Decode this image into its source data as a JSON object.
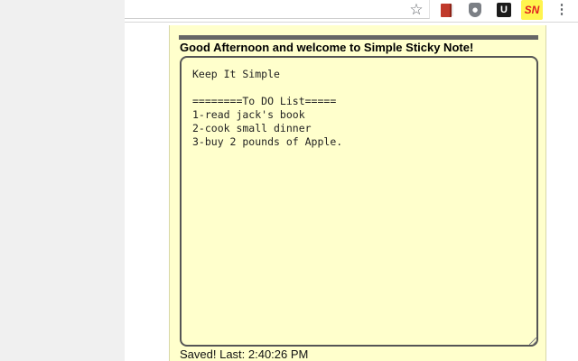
{
  "browser": {
    "toolbar_icons": [
      "bookmark-star-icon",
      "book-extension-icon",
      "shield-extension-icon",
      "u-extension-icon",
      "simple-sticky-note-extension-icon",
      "menu-dots-icon"
    ],
    "star_glyph": "☆",
    "u_extension_label": "U",
    "sn_extension_label": "SN",
    "menu_glyph": "⋮"
  },
  "popup": {
    "greeting": "Good Afternoon and welcome to Simple Sticky Note!",
    "note_text": "Keep It Simple\n\n========To DO List=====\n1-read jack's book\n2-cook small dinner\n3-buy 2 pounds of Apple.",
    "status": "Saved! Last: 2:40:26 PM"
  },
  "colors": {
    "note_background": "#ffffcc",
    "note_border": "#555555",
    "sn_badge_background": "#fff44f",
    "sn_badge_text": "#e02020"
  }
}
